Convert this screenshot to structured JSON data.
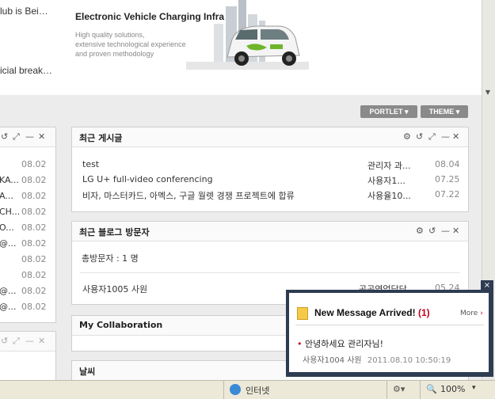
{
  "banner": {
    "title": "Electronic Vehicle Charging Infra",
    "subtitle_lines": [
      "High quality solutions,",
      "extensive technological experience",
      "and proven methodology"
    ],
    "left_fragments": [
      "lub is Bei…",
      "icial break…"
    ]
  },
  "toolbar": {
    "portlet_label": "PORTLET",
    "theme_label": "THEME"
  },
  "left_panel": {
    "rows": [
      {
        "text": "",
        "date": "08.02"
      },
      {
        "text": "KA...",
        "date": "08.02"
      },
      {
        "text": "A...",
        "date": "08.02"
      },
      {
        "text": "CH...",
        "date": "08.02"
      },
      {
        "text": "O...",
        "date": "08.02"
      },
      {
        "text": "@...",
        "date": "08.02"
      },
      {
        "text": "",
        "date": "08.02"
      },
      {
        "text": "",
        "date": "08.02"
      },
      {
        "text": "@...",
        "date": "08.02"
      },
      {
        "text": "@...",
        "date": "08.02"
      }
    ]
  },
  "recent_posts": {
    "title": "최근 게시글",
    "rows": [
      {
        "title": "test",
        "author": "관리자 과...",
        "date": "08.04"
      },
      {
        "title": "LG U+ full-video conferencing",
        "author": "사용자1...",
        "date": "07.25"
      },
      {
        "title": "비자, 마스터카드, 아멕스, 구글 월렛 경쟁 프로젝트에 합류",
        "author": "사용율10...",
        "date": "07.22"
      }
    ]
  },
  "blog_visitors": {
    "title": "최근 블로그 방문자",
    "total": "총방문자 : 1 명",
    "visitor_name": "사용자1005 사원",
    "visitor_dept": "공공영업담당",
    "visitor_date": "05.24"
  },
  "collaboration": {
    "title": "My Collaboration"
  },
  "weather": {
    "title": "날씨"
  },
  "popup": {
    "heading": "New Message Arrived!",
    "count": "(1)",
    "more_label": "More",
    "message": "안녕하세요 관리자님!",
    "sender": "사용자1004 사원",
    "timestamp": "2011.08.10 10:50:19",
    "close_label": "×"
  },
  "statusbar": {
    "zone": "인터넷",
    "zoom": "100%"
  },
  "colors": {
    "popup_border": "#2e3c52",
    "count_red": "#c0001a",
    "portlet_btn": "#8a8a8a"
  }
}
